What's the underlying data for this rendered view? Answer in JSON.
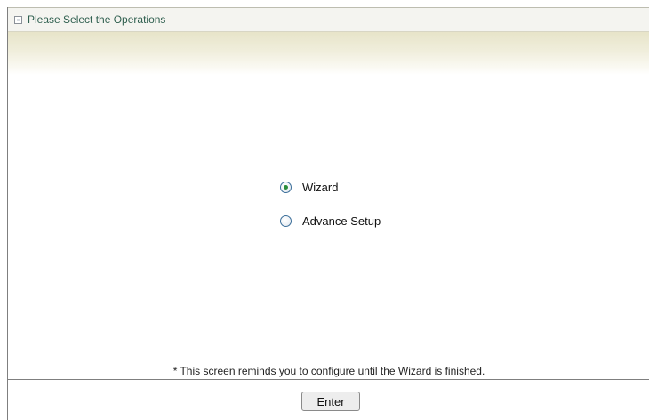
{
  "header": {
    "title": "Please Select the Operations"
  },
  "options": [
    {
      "label": "Wizard",
      "selected": true
    },
    {
      "label": "Advance Setup",
      "selected": false
    }
  ],
  "note": "* This screen reminds you to configure until the Wizard is finished.",
  "buttons": {
    "enter_label": "Enter"
  },
  "colors": {
    "title_text": "#2f5f4f",
    "band": "#e7e4c9",
    "radio_dot": "#2a8c3a"
  }
}
